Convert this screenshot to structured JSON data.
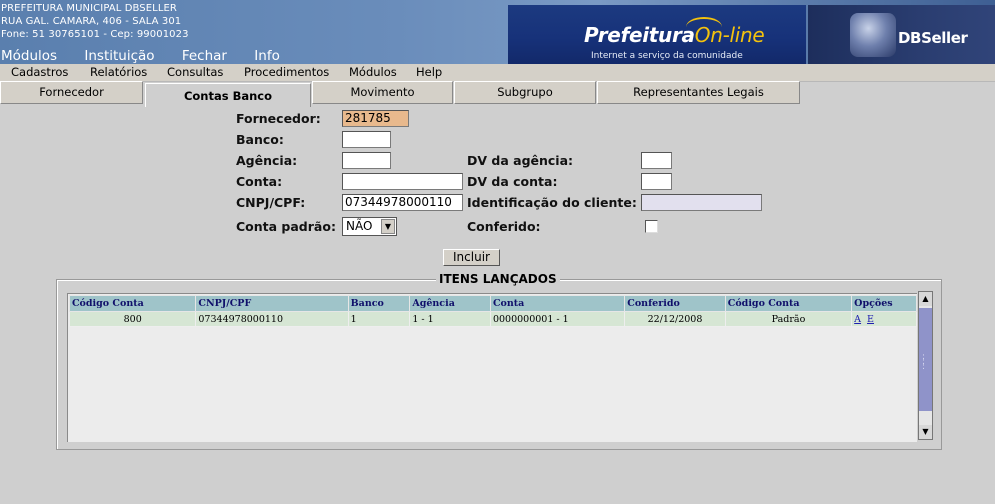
{
  "header": {
    "institution": "PREFEITURA MUNICIPAL DBSELLER",
    "address": "RUA GAL. CAMARA, 406 - SALA 301",
    "contact": "Fone: 51 30765101  -  Cep: 99001023",
    "top_menu": [
      "Módulos",
      "Instituição",
      "Fechar",
      "Info"
    ],
    "logo_prefeitura": {
      "main": "Prefeitura",
      "accent": "On-line",
      "tagline": "Internet a serviço da comunidade"
    },
    "logo_dbseller": "DBSeller"
  },
  "menubar": [
    "Cadastros",
    "Relatórios",
    "Consultas",
    "Procedimentos",
    "Módulos",
    "Help"
  ],
  "tabs": [
    "Fornecedor",
    "Contas Banco",
    "Movimento",
    "Subgrupo",
    "Representantes Legais"
  ],
  "active_tab": "Contas Banco",
  "form": {
    "fornecedor_label": "Fornecedor:",
    "fornecedor_value": "281785",
    "banco_label": "Banco:",
    "banco_value": "",
    "agencia_label": "Agência:",
    "agencia_value": "",
    "dv_agencia_label": "DV da agência:",
    "dv_agencia_value": "",
    "conta_label": "Conta:",
    "conta_value": "",
    "dv_conta_label": "DV da conta:",
    "dv_conta_value": "",
    "cnpj_label": "CNPJ/CPF:",
    "cnpj_value": "07344978000110",
    "id_cliente_label": "Identificação do cliente:",
    "id_cliente_value": "",
    "conta_padrao_label": "Conta padrão:",
    "conta_padrao_value": "NÃO",
    "conferido_label": "Conferido:",
    "conferido_checked": false,
    "incluir_button": "Incluir"
  },
  "itens": {
    "legend": "ITENS LANÇADOS",
    "columns": [
      "Código Conta",
      "CNPJ/CPF",
      "Banco",
      "Agência",
      "Conta",
      "Conferido",
      "Código Conta",
      "Opções"
    ],
    "rows": [
      {
        "codigo_conta": "800",
        "cnpj_cpf": "07344978000110",
        "banco": "1",
        "agencia": "1 - 1",
        "conta": "0000000001 - 1",
        "conferido": "22/12/2008",
        "codigo_conta_tipo": "Padrão",
        "opcao_alterar": "A",
        "opcao_excluir": "E"
      }
    ]
  },
  "colors": {
    "header_blue": "#5a7fae",
    "grid_header": "#9fc4c9",
    "grid_row": "#d6e6d4",
    "readonly_orange": "#e8b98d",
    "scroll_thumb": "#8f93c9"
  }
}
